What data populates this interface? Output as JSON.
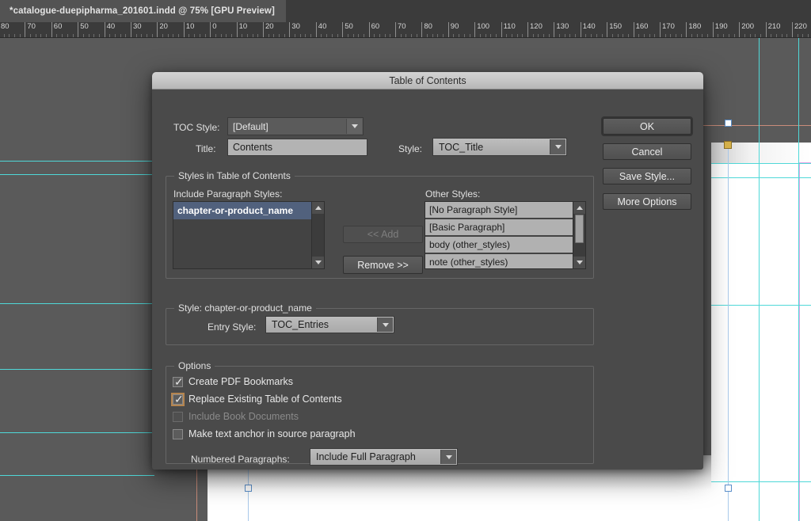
{
  "app": {
    "document_tab": "*catalogue-duepipharma_201601.indd @ 75% [GPU Preview]",
    "ruler_labels": [
      "80",
      "70",
      "60",
      "50",
      "40",
      "30",
      "20",
      "10",
      "0",
      "10",
      "20",
      "30",
      "40",
      "50",
      "60",
      "70",
      "80",
      "90",
      "100",
      "110",
      "120",
      "130",
      "140",
      "150",
      "160",
      "170",
      "180",
      "190",
      "200",
      "210",
      "220"
    ]
  },
  "dialog": {
    "title": "Table of Contents",
    "toc_style": {
      "label": "TOC Style:",
      "value": "[Default]"
    },
    "title_field": {
      "label": "Title:",
      "value": "Contents"
    },
    "title_style": {
      "label": "Style:",
      "value": "TOC_Title"
    },
    "buttons": {
      "ok": "OK",
      "cancel": "Cancel",
      "save_style": "Save Style...",
      "more_options": "More Options"
    },
    "styles_group": {
      "title": "Styles in Table of Contents",
      "include_label": "Include Paragraph Styles:",
      "include_items": [
        "chapter-or-product_name"
      ],
      "other_label": "Other Styles:",
      "other_items": [
        "[No Paragraph Style]",
        "[Basic Paragraph]",
        "body (other_styles)",
        "note (other_styles)"
      ],
      "add_button": "<< Add",
      "remove_button": "Remove >>"
    },
    "entry_group": {
      "title": "Style: chapter-or-product_name",
      "entry_style_label": "Entry Style:",
      "entry_style_value": "TOC_Entries"
    },
    "options_group": {
      "title": "Options",
      "checkboxes": [
        {
          "label": "Create PDF Bookmarks",
          "checked": true,
          "disabled": false,
          "focused": false
        },
        {
          "label": "Replace Existing Table of Contents",
          "checked": true,
          "disabled": false,
          "focused": true
        },
        {
          "label": "Include Book Documents",
          "checked": false,
          "disabled": true,
          "focused": false
        },
        {
          "label": "Make text anchor in source paragraph",
          "checked": false,
          "disabled": false,
          "focused": false
        }
      ],
      "numbered_label": "Numbered Paragraphs:",
      "numbered_value": "Include Full Paragraph"
    }
  },
  "colors": {
    "dialog_bg": "#4a4a4a",
    "canvas_bg": "#5a5a5a",
    "selection_blue": "#51617d",
    "focus_orange": "#b5854f",
    "guide_cyan": "#4fd8d8",
    "guide_magenta": "#e6a4e6",
    "anchor_gold": "#d8b34a"
  }
}
